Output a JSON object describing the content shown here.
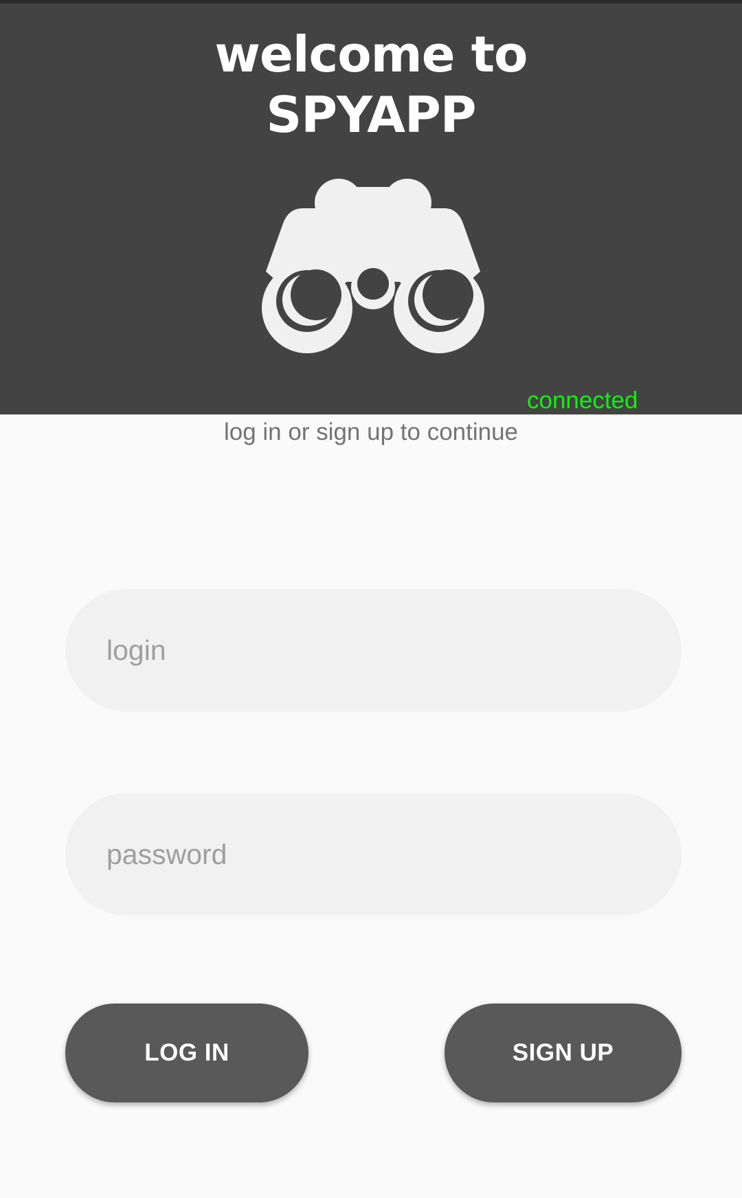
{
  "header": {
    "title_line1": "welcome to",
    "title_line2": "SPYAPP",
    "logo_icon": "binoculars-icon",
    "status_text": "connected",
    "status_color": "#12ef12",
    "background_color": "#434343"
  },
  "subtitle": "log in or sign up to continue",
  "form": {
    "login_placeholder": "login",
    "password_placeholder": "password"
  },
  "buttons": {
    "login_label": "LOG IN",
    "signup_label": "SIGN UP",
    "color": "#595959"
  }
}
